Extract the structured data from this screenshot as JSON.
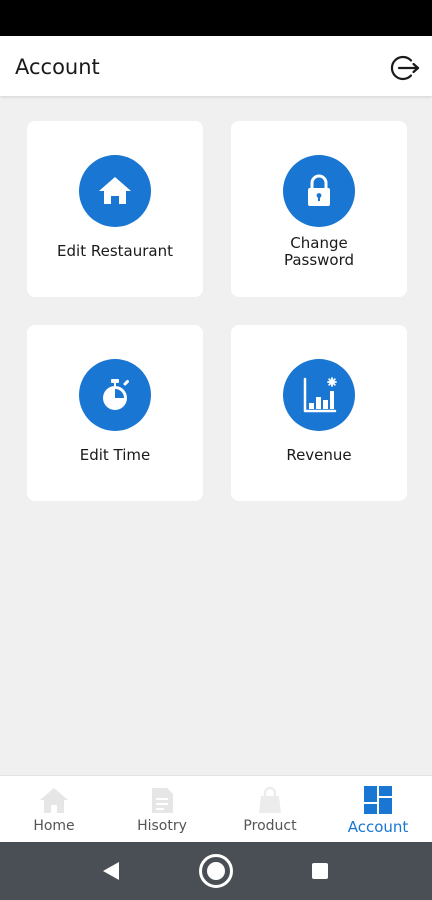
{
  "header": {
    "title": "Account",
    "logout_icon": "logout-icon"
  },
  "cards": [
    {
      "label": "Edit Restaurant",
      "icon": "home-icon"
    },
    {
      "label": "Change\nPassword",
      "icon": "lock-icon"
    },
    {
      "label": "Edit Time",
      "icon": "stopwatch-icon"
    },
    {
      "label": "Revenue",
      "icon": "bar-chart-icon"
    }
  ],
  "bottom_nav": {
    "items": [
      {
        "label": "Home",
        "icon": "home-icon",
        "active": false
      },
      {
        "label": "Hisotry",
        "icon": "document-icon",
        "active": false
      },
      {
        "label": "Product",
        "icon": "shopping-bag-icon",
        "active": false
      },
      {
        "label": "Account",
        "icon": "dashboard-icon",
        "active": true
      }
    ]
  },
  "system_nav": {
    "back_icon": "back-triangle-icon",
    "home_icon": "home-circle-icon",
    "recents_icon": "recents-square-icon"
  },
  "colors": {
    "accent": "#1976d2",
    "background": "#f0f0f0",
    "card": "#ffffff",
    "inactive_nav_icon": "#e6e6e6",
    "system_bar": "#4a4f55",
    "status_bar": "#000000"
  }
}
